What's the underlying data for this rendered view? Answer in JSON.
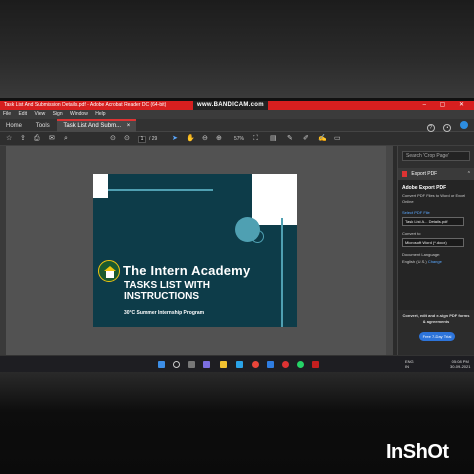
{
  "window": {
    "title": "Task List And Submission Details.pdf - Adobe Acrobat Reader DC (64-bit)",
    "watermark": "www.BANDICAM.com",
    "controls": "– ▢ ✕"
  },
  "menu": [
    "File",
    "Edit",
    "View",
    "Sign",
    "Window",
    "Help"
  ],
  "nav": {
    "tabs": [
      "Home",
      "Tools",
      "Task List And Subm..."
    ],
    "close": "×"
  },
  "toolbar": {
    "page_current": "1",
    "page_total": "/ 29",
    "zoom": "57%"
  },
  "slide": {
    "title": "The Intern Academy",
    "subtitle_line1": "TASKS LIST WITH",
    "subtitle_line2": "INSTRUCTIONS",
    "program": "30°C Summer Internship Program",
    "colors": {
      "background": "#0d3c49",
      "accent": "#4fa0b2"
    }
  },
  "right_panel": {
    "search_placeholder": "Search 'Crop Page'",
    "header": "Export PDF",
    "section_title": "Adobe Export PDF",
    "description": "Convert PDF Files to Word or Excel Online",
    "select_label": "Select PDF File",
    "selected_file": "Task List A... Details.pdf",
    "convert_label": "Convert to",
    "convert_value": "Microsoft Word (*.docx)",
    "language_label": "Document Language:",
    "language_value": "English (U.S.)",
    "change_link": "Change",
    "footer_text": "Convert, edit and e-sign PDF forms & agreements",
    "trial_button": "Free 7-Day Trial"
  },
  "taskbar": {
    "lang": "ENG",
    "region": "IN",
    "time": "05:08 PM",
    "date": "30-09-2021"
  },
  "overlay": {
    "brand": "InShOt"
  }
}
